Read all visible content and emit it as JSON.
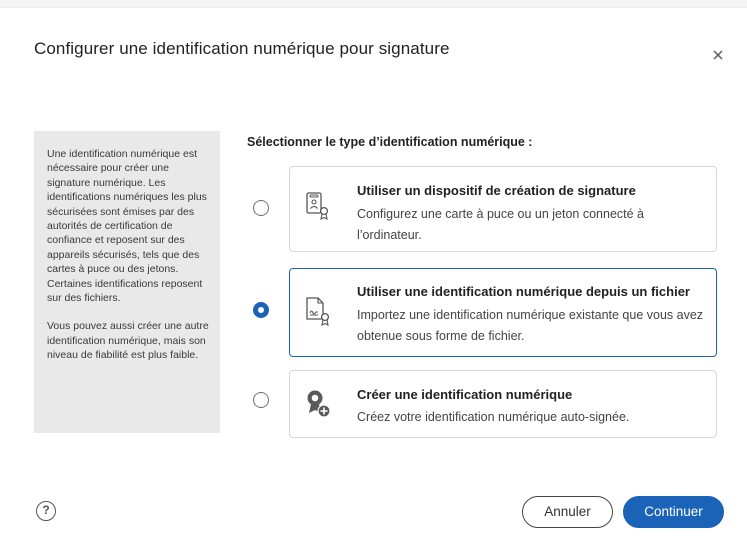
{
  "dialog": {
    "title": "Configurer une identification numérique pour signature",
    "close_icon": "close-icon"
  },
  "info_panel": {
    "paragraph_1": "Une identification numérique est nécessaire pour créer une signature numérique. Les identifications numériques les plus sécurisées sont émises par des autorités de certification de confiance et reposent sur des appareils sécurisés, tels que des cartes à puce ou des jetons. Certaines identifications reposent sur des fichiers.",
    "paragraph_2": "Vous pouvez aussi créer une autre identification numérique, mais son niveau de fiabilité est plus faible."
  },
  "selection": {
    "label": "Sélectionner le type d’identification numérique :",
    "options": [
      {
        "title": "Utiliser un dispositif de création de signature",
        "description": "Configurez une carte à puce ou un jeton connecté à l’ordinateur.",
        "icon": "device-badge-icon",
        "selected": false
      },
      {
        "title": "Utiliser une identification numérique depuis un fichier",
        "description": "Importez une identification numérique existante que vous avez obtenue sous forme de fichier.",
        "icon": "signed-file-icon",
        "selected": true
      },
      {
        "title": "Créer une identification numérique",
        "description": "Créez votre identification numérique auto-signée.",
        "icon": "new-certificate-icon",
        "selected": false
      }
    ]
  },
  "footer": {
    "help_label": "?",
    "cancel_label": "Annuler",
    "continue_label": "Continuer"
  },
  "colors": {
    "accent": "#1b63b8",
    "info_background": "#e9e9e9",
    "border": "#d7d7d7"
  }
}
